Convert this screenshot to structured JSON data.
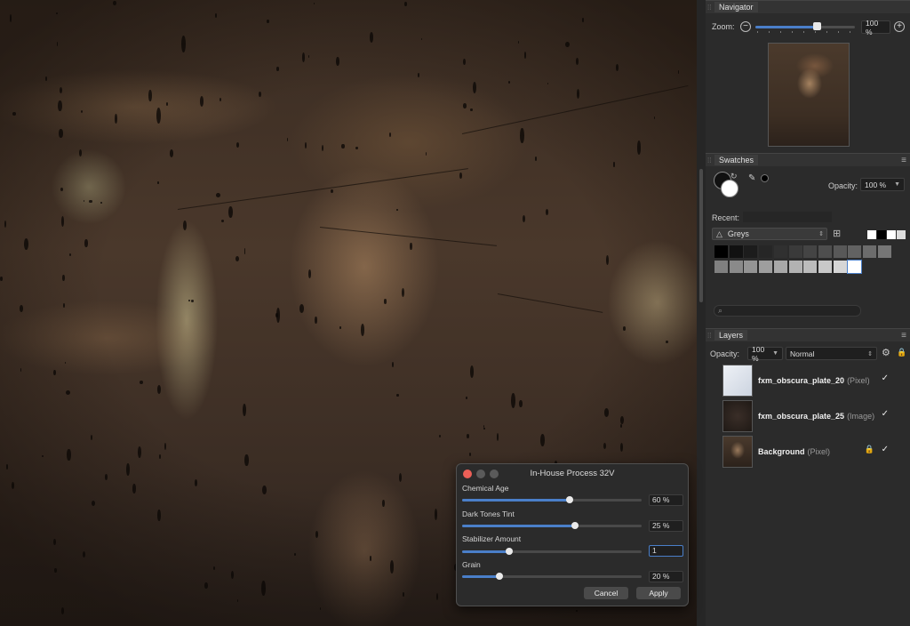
{
  "navigator": {
    "title": "Navigator",
    "zoom_label": "Zoom:",
    "zoom_value": "100 %",
    "zoom_level": 0.62
  },
  "swatches": {
    "title": "Swatches",
    "opacity_label": "Opacity:",
    "opacity_value": "100 %",
    "recent_label": "Recent:",
    "palette": "Greys",
    "search_placeholder": "",
    "row1": [
      "#000000",
      "#111111",
      "#1c1c1c",
      "#262626",
      "#303030",
      "#3a3a3a",
      "#444444",
      "#4e4e4e",
      "#585858",
      "#626262",
      "#6c6c6c",
      "#767676"
    ],
    "row2": [
      "#808080",
      "#8a8a8a",
      "#949494",
      "#9e9e9e",
      "#a8a8a8",
      "#b2b2b2",
      "#bcbcbc",
      "#c8c8c8",
      "#d6d6d6",
      "#ffffff"
    ],
    "recent_colors": [
      "#ffffff",
      "#000000",
      "#ffffff",
      "#dddddd"
    ]
  },
  "layers": {
    "title": "Layers",
    "opacity_label": "Opacity:",
    "opacity_value": "100 %",
    "blend_mode": "Normal",
    "items": [
      {
        "name": "fxm_obscura_plate_20",
        "type": "(Pixel)",
        "checked": "✓",
        "locked": false
      },
      {
        "name": "fxm_obscura_plate_25",
        "type": "(Image)",
        "checked": "✓",
        "locked": false
      },
      {
        "name": "Background",
        "type": "(Pixel)",
        "checked": "✓",
        "locked": true
      }
    ]
  },
  "dialog": {
    "title": "In-House Process 32V",
    "sliders": [
      {
        "label": "Chemical Age",
        "value": "60 %",
        "level": 0.6
      },
      {
        "label": "Dark Tones Tint",
        "value": "25 %",
        "level": 0.63
      },
      {
        "label": "Stabilizer Amount",
        "value": "1",
        "level": 0.26
      },
      {
        "label": "Grain",
        "value": "20 %",
        "level": 0.21
      }
    ],
    "cancel_label": "Cancel",
    "apply_label": "Apply"
  },
  "colors": {
    "accent": "#4a7fc9",
    "close_light": "#ec5f57"
  }
}
